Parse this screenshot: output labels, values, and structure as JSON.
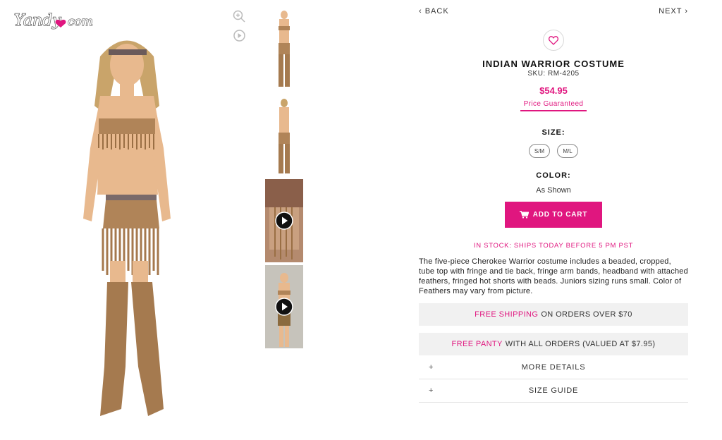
{
  "logo": {
    "text": "Yandy",
    "suffix": "com"
  },
  "nav": {
    "back": "‹ BACK",
    "next": "NEXT ›"
  },
  "icons": {
    "zoom": "zoom-in-icon",
    "play": "play-icon",
    "heart": "heart-icon",
    "cart": "cart-icon"
  },
  "product": {
    "title": "INDIAN WARRIOR COSTUME",
    "sku": "SKU: RM-4205",
    "price": "$54.95",
    "price_guarantee": "Price Guaranteed",
    "size_label": "SIZE:",
    "sizes": [
      "S/M",
      "M/L"
    ],
    "color_label": "COLOR:",
    "color_value": "As Shown",
    "add_to_cart": "ADD TO CART",
    "stock": "IN STOCK: SHIPS TODAY BEFORE 5 PM PST",
    "description": "The five-piece Cherokee Warrior costume includes a beaded, cropped, tube top with fringe and tie back, fringe arm bands, headband with attached feathers, fringed hot shorts with beads. Juniors sizing runs small. Color of Feathers may vary from picture."
  },
  "promos": [
    {
      "highlight": "FREE SHIPPING",
      "text": "ON ORDERS OVER $70"
    },
    {
      "highlight": "FREE PANTY",
      "text": "WITH ALL ORDERS (VALUED AT $7.95)"
    }
  ],
  "accordions": [
    {
      "icon": "+",
      "label": "MORE DETAILS"
    },
    {
      "icon": "+",
      "label": "SIZE GUIDE"
    }
  ],
  "colors": {
    "accent": "#e0167f",
    "costume": "#b08458",
    "skin": "#e8b98e",
    "promo_bg": "#f1f1f1"
  }
}
